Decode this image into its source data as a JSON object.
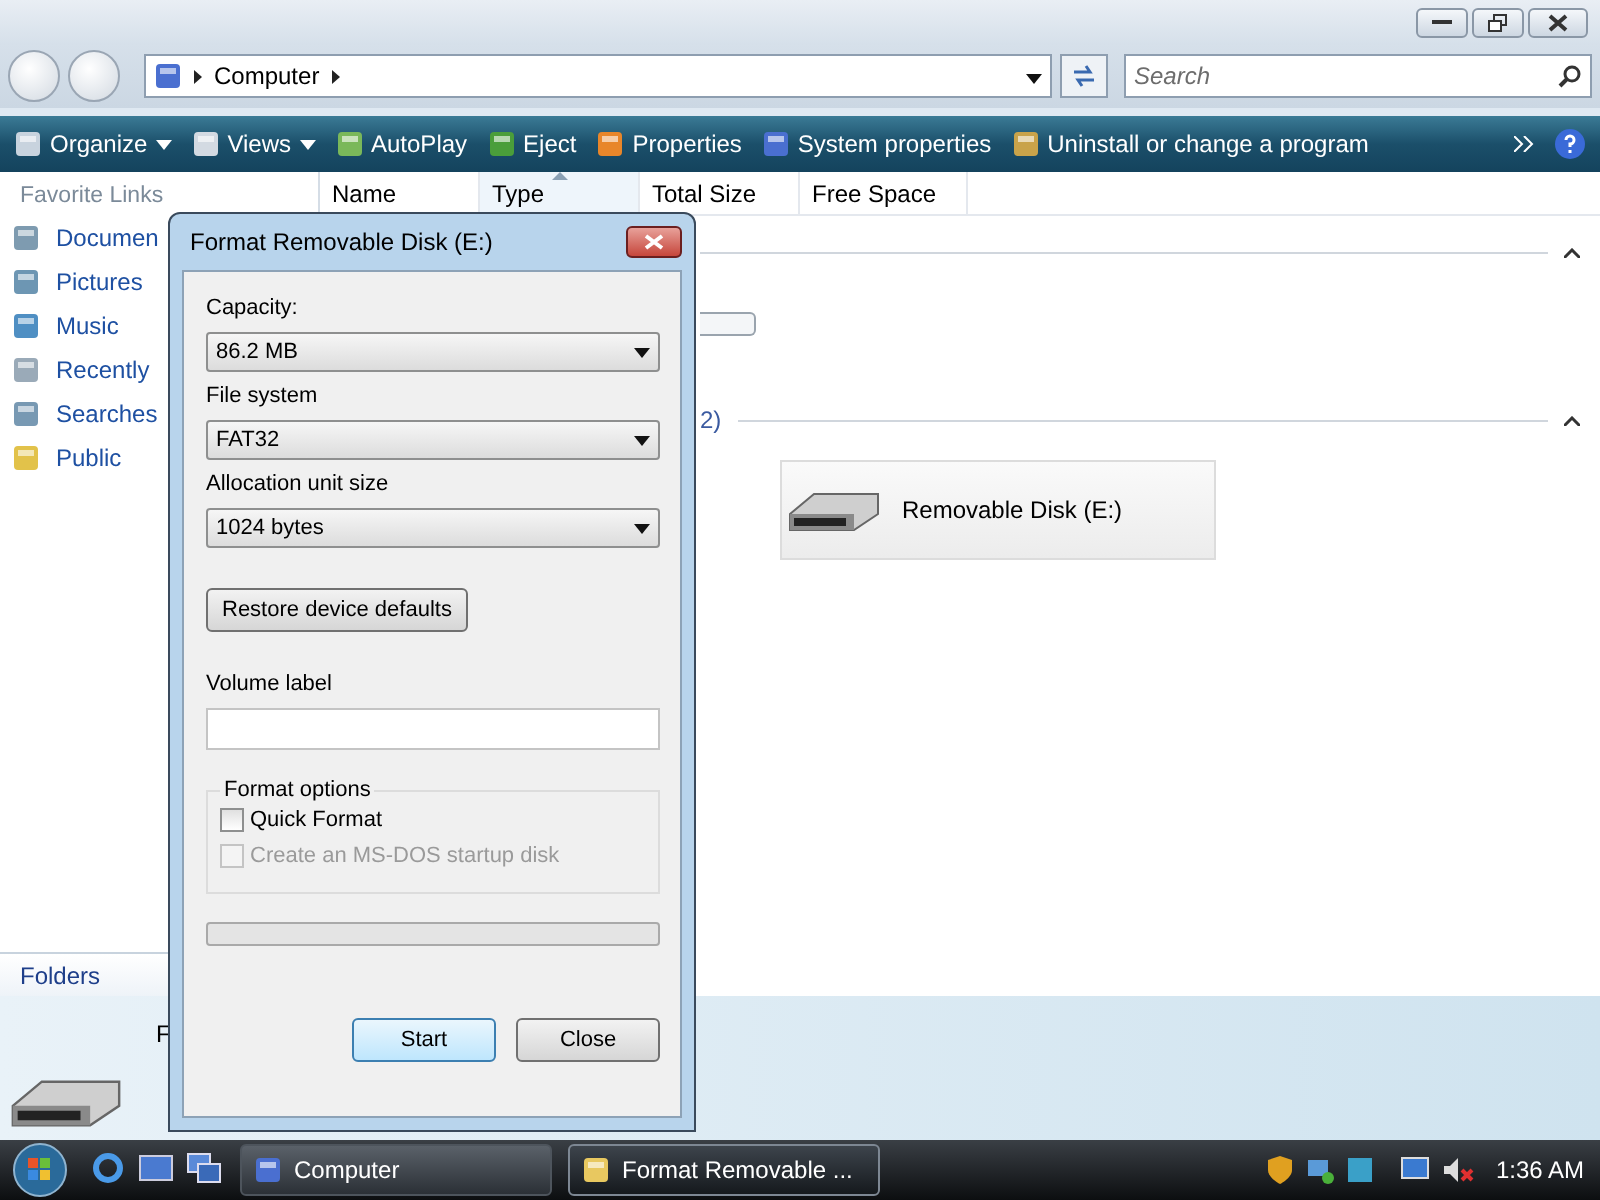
{
  "window": {
    "address": [
      "Computer"
    ],
    "search": {
      "placeholder": "Search"
    }
  },
  "toolbar": [
    {
      "label": "Organize",
      "kind": "menu"
    },
    {
      "label": "Views",
      "kind": "menu"
    },
    {
      "label": "AutoPlay",
      "kind": "action"
    },
    {
      "label": "Eject",
      "kind": "action"
    },
    {
      "label": "Properties",
      "kind": "action"
    },
    {
      "label": "System properties",
      "kind": "action"
    },
    {
      "label": "Uninstall or change a program",
      "kind": "action"
    }
  ],
  "favorite_links": {
    "title": "Favorite Links",
    "items": [
      "Documen",
      "Pictures",
      "Music",
      "Recently",
      "Searches",
      "Public"
    ]
  },
  "folders_label": "Folders",
  "columns": [
    {
      "label": "Name",
      "sorted": false
    },
    {
      "label": "Type",
      "sorted": true
    },
    {
      "label": "Total Size",
      "sorted": false
    },
    {
      "label": "Free Space",
      "sorted": false
    }
  ],
  "content": {
    "group_header_fragment": "2)",
    "drive_tile": "Removable Disk (E:)"
  },
  "details_pane": {
    "text_fragment": "F"
  },
  "dialog": {
    "title": "Format Removable Disk (E:)",
    "fields": [
      {
        "label": "Capacity:",
        "value": "86.2 MB"
      },
      {
        "label": "File system",
        "value": "FAT32"
      },
      {
        "label": "Allocation unit size",
        "value": "1024 bytes"
      }
    ],
    "restore_button": "Restore device defaults",
    "volume_label": {
      "label": "Volume label"
    },
    "options_title": "Format options",
    "options": [
      {
        "label": "Quick Format",
        "checked": false,
        "disabled": false
      },
      {
        "label": "Create an MS-DOS startup disk",
        "checked": false,
        "disabled": true
      }
    ],
    "progress": {
      "level": 0
    },
    "buttons": [
      {
        "label": "Start",
        "default": true
      },
      {
        "label": "Close",
        "default": false
      }
    ]
  },
  "taskbar": {
    "tasks": [
      {
        "label": "Computer",
        "selected": false
      },
      {
        "label": "Format Removable ...",
        "selected": true
      }
    ],
    "clock": "1:36 AM"
  }
}
